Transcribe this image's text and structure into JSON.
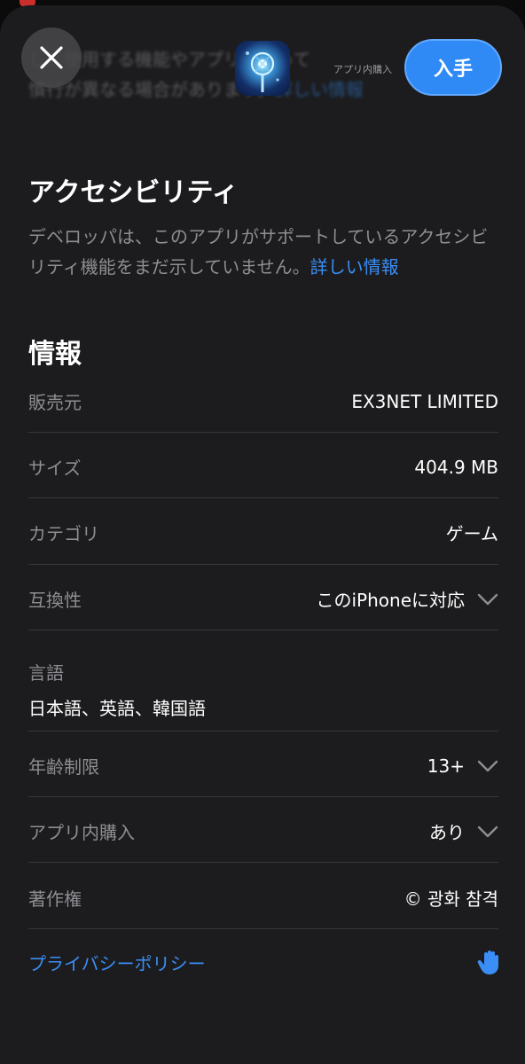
{
  "background_text": {
    "line1": "し、使用する機能やアプリによって",
    "line2": "慣行が異なる場合があります。",
    "line2_link": "詳しい情報"
  },
  "header": {
    "close_icon": "close-icon",
    "iap_note": "アプリ内購入",
    "get_label": "入手"
  },
  "accessibility": {
    "title": "アクセシビリティ",
    "description": "デベロッパは、このアプリがサポートしているアクセシビリティ機能をまだ示していません。",
    "link": "詳しい情報"
  },
  "info": {
    "title": "情報",
    "seller": {
      "label": "販売元",
      "value": "EX3NET LIMITED"
    },
    "size": {
      "label": "サイズ",
      "value": "404.9 MB"
    },
    "category": {
      "label": "カテゴリ",
      "value": "ゲーム"
    },
    "compatibility": {
      "label": "互換性",
      "value": "このiPhoneに対応"
    },
    "languages": {
      "label": "言語",
      "value": "日本語、英語、韓国語"
    },
    "age_rating": {
      "label": "年齢制限",
      "value": "13+"
    },
    "in_app_purchases": {
      "label": "アプリ内購入",
      "value": "あり"
    },
    "copyright": {
      "label": "著作権",
      "value": "© 광화 참격"
    },
    "privacy_policy": {
      "label": "プライバシーポリシー",
      "icon": "hand-raised-icon"
    }
  },
  "colors": {
    "accent": "#3a8ef5",
    "sheet_background": "#1c1c1e",
    "secondary_text": "#8e8e93"
  }
}
